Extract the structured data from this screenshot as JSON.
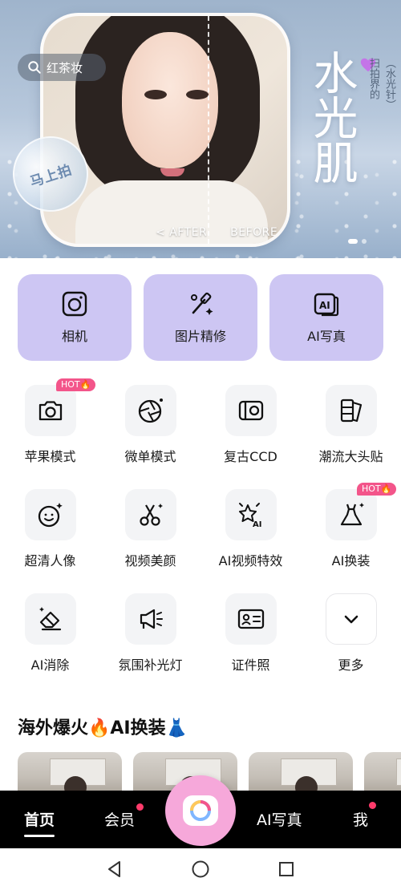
{
  "banner": {
    "search_label": "红茶妆",
    "shoot_label": "马上拍",
    "after_label": "< AFTER",
    "before_label": "BEFORE >",
    "title": "水光肌",
    "subtitle_line1": "扫拍界的",
    "subtitle_line2": "（水光针）"
  },
  "main_tiles": [
    {
      "label": "相机",
      "icon": "camera-icon"
    },
    {
      "label": "图片精修",
      "icon": "magic-wand-icon"
    },
    {
      "label": "AI写真",
      "icon": "ai-portrait-icon"
    }
  ],
  "tools": [
    {
      "label": "苹果模式",
      "icon": "camera-icon",
      "badge": "HOT🔥"
    },
    {
      "label": "微单模式",
      "icon": "aperture-icon",
      "badge": ""
    },
    {
      "label": "复古CCD",
      "icon": "ccd-camera-icon",
      "badge": ""
    },
    {
      "label": "潮流大头贴",
      "icon": "photo-strip-icon",
      "badge": ""
    },
    {
      "label": "超清人像",
      "icon": "face-sparkle-icon",
      "badge": ""
    },
    {
      "label": "视频美颜",
      "icon": "scissors-icon",
      "badge": ""
    },
    {
      "label": "AI视频特效",
      "icon": "ai-star-icon",
      "badge": ""
    },
    {
      "label": "AI换装",
      "icon": "dress-icon",
      "badge": "HOT🔥"
    },
    {
      "label": "AI消除",
      "icon": "eraser-icon",
      "badge": ""
    },
    {
      "label": "氛围补光灯",
      "icon": "fill-light-icon",
      "badge": ""
    },
    {
      "label": "证件照",
      "icon": "id-card-icon",
      "badge": ""
    },
    {
      "label": "更多",
      "icon": "chevron-down-icon",
      "badge": ""
    }
  ],
  "section": {
    "title": "海外爆火🔥AI换装👗"
  },
  "nav": {
    "home": "首页",
    "member": "会员",
    "ai_portrait": "AI写真",
    "me": "我"
  },
  "colors": {
    "tile_bg": "#cdc6f3",
    "hot_badge": "#f3558a",
    "nav_bg": "#000000",
    "camera_btn": "#f6a8da",
    "notify_dot": "#ff3b6b"
  }
}
